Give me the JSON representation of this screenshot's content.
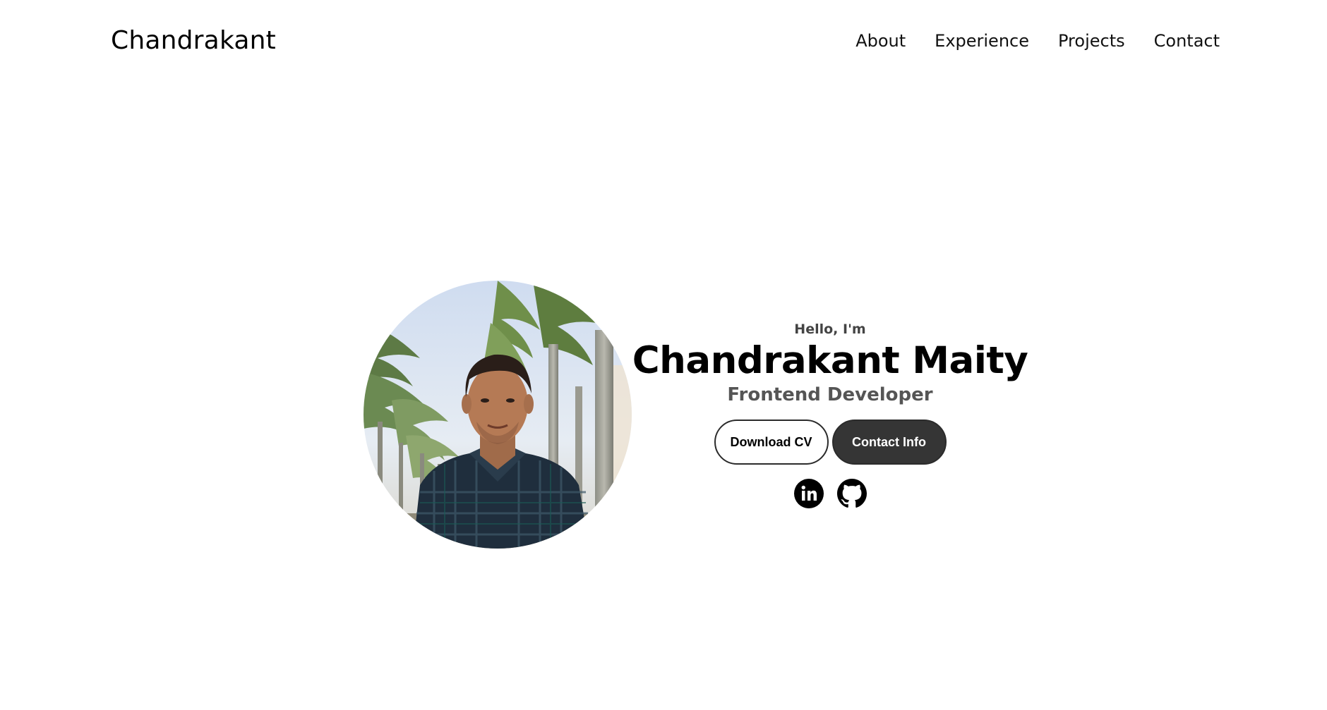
{
  "nav": {
    "logo": "Chandrakant",
    "links": [
      "About",
      "Experience",
      "Projects",
      "Contact"
    ]
  },
  "hero": {
    "greeting": "Hello, I'm",
    "name": "Chandrakant Maity",
    "role": "Frontend Developer",
    "download_label": "Download CV",
    "contact_label": "Contact Info",
    "socials": [
      {
        "icon": "linkedin-icon"
      },
      {
        "icon": "github-icon"
      }
    ]
  },
  "colors": {
    "background": "#ffffff",
    "text": "#000000",
    "button_dark": "#353535"
  }
}
